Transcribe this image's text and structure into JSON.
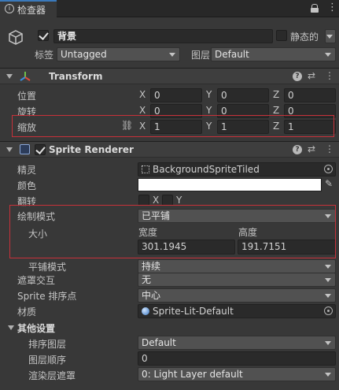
{
  "tab": {
    "title": "检查器"
  },
  "gameobject": {
    "active": true,
    "name": "背景",
    "static_label": "静态的",
    "tag_label": "标签",
    "tag_value": "Untagged",
    "layer_label": "图层",
    "layer_value": "Default"
  },
  "transform": {
    "title": "Transform",
    "position": {
      "label": "位置",
      "x": "0",
      "y": "0",
      "z": "0"
    },
    "rotation": {
      "label": "旋转",
      "x": "0",
      "y": "0",
      "z": "0"
    },
    "scale": {
      "label": "缩放",
      "x": "1",
      "y": "1",
      "z": "1"
    }
  },
  "axes": {
    "x": "X",
    "y": "Y",
    "z": "Z"
  },
  "sprite_renderer": {
    "title": "Sprite Renderer",
    "enabled": true,
    "sprite_label": "精灵",
    "sprite_value": "BackgroundSpriteTiled",
    "color_label": "颜色",
    "color_value": "#ffffff",
    "flip_label": "翻转",
    "flip_x": "X",
    "flip_y": "Y",
    "draw_mode_label": "绘制模式",
    "draw_mode_value": "已平铺",
    "size_label": "大小",
    "width_label": "宽度",
    "height_label": "高度",
    "width_value": "301.1945",
    "height_value": "191.7151",
    "tile_mode_label": "平铺模式",
    "tile_mode_value": "持续",
    "mask_label": "遮罩交互",
    "mask_value": "无",
    "sort_point_label": "Sprite 排序点",
    "sort_point_value": "中心",
    "material_label": "材质",
    "material_value": "Sprite-Lit-Default"
  },
  "additional": {
    "title": "其他设置",
    "sorting_layer_label": "排序图层",
    "sorting_layer_value": "Default",
    "order_label": "图层顺序",
    "order_value": "0",
    "light_mask_label": "渲染层遮罩",
    "light_mask_value": "0: Light Layer default"
  }
}
